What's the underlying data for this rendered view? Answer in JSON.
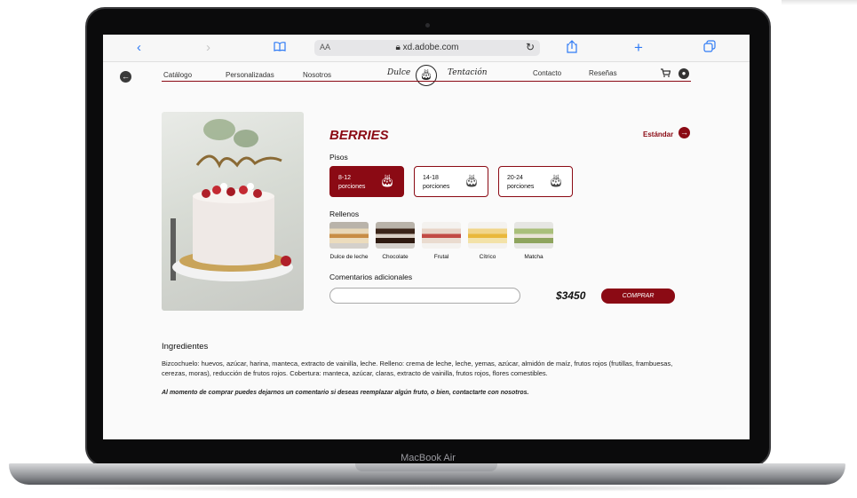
{
  "browser": {
    "url": "xd.adobe.com",
    "text_size_label": "AA",
    "icons": [
      "chevron-left-icon",
      "chevron-right-icon",
      "book-icon",
      "lock-icon",
      "reload-icon",
      "share-icon",
      "plus-icon",
      "tabs-icon"
    ]
  },
  "nav": {
    "links": [
      "Catálogo",
      "Personalizadas",
      "Nosotros",
      "Contacto",
      "Reseñas"
    ],
    "logo_left": "Dulce",
    "logo_right": "Tentación"
  },
  "product": {
    "title": "BERRIES",
    "estandar_label": "Estándar",
    "pisos_label": "Pisos",
    "pisos": [
      {
        "line1": "8-12",
        "line2": "porciones",
        "selected": true
      },
      {
        "line1": "14-18",
        "line2": "porciones",
        "selected": false
      },
      {
        "line1": "20-24",
        "line2": "porciones",
        "selected": false
      }
    ],
    "rellenos_label": "Rellenos",
    "rellenos": [
      "Dulce de leche",
      "Chocolate",
      "Frutal",
      "Cítrico",
      "Matcha"
    ],
    "comentarios_label": "Comentarios adicionales",
    "comment_value": "",
    "price": "$3450",
    "buy_label": "COMPRAR"
  },
  "ingredientes": {
    "title": "Ingredientes",
    "text": "Bizcochuelo: huevos, azúcar, harina, manteca, extracto de vainilla, leche. Relleno: crema de leche, leche, yemas, azúcar, almidón de maíz, frutos rojos (frutillas, frambuesas, cerezas, moras), reducción de frutos rojos. Cobertura: manteca, azúcar, claras, extracto de vainilla, frutos rojos, flores comestibles.",
    "note": "Al momento de comprar puedes dejarnos un comentario si deseas reemplazar algún fruto, o bien, contactarte con nosotros."
  },
  "device_label": "MacBook Air",
  "colors": {
    "accent": "#8b0a14",
    "browser_blue": "#2f7bf5"
  }
}
